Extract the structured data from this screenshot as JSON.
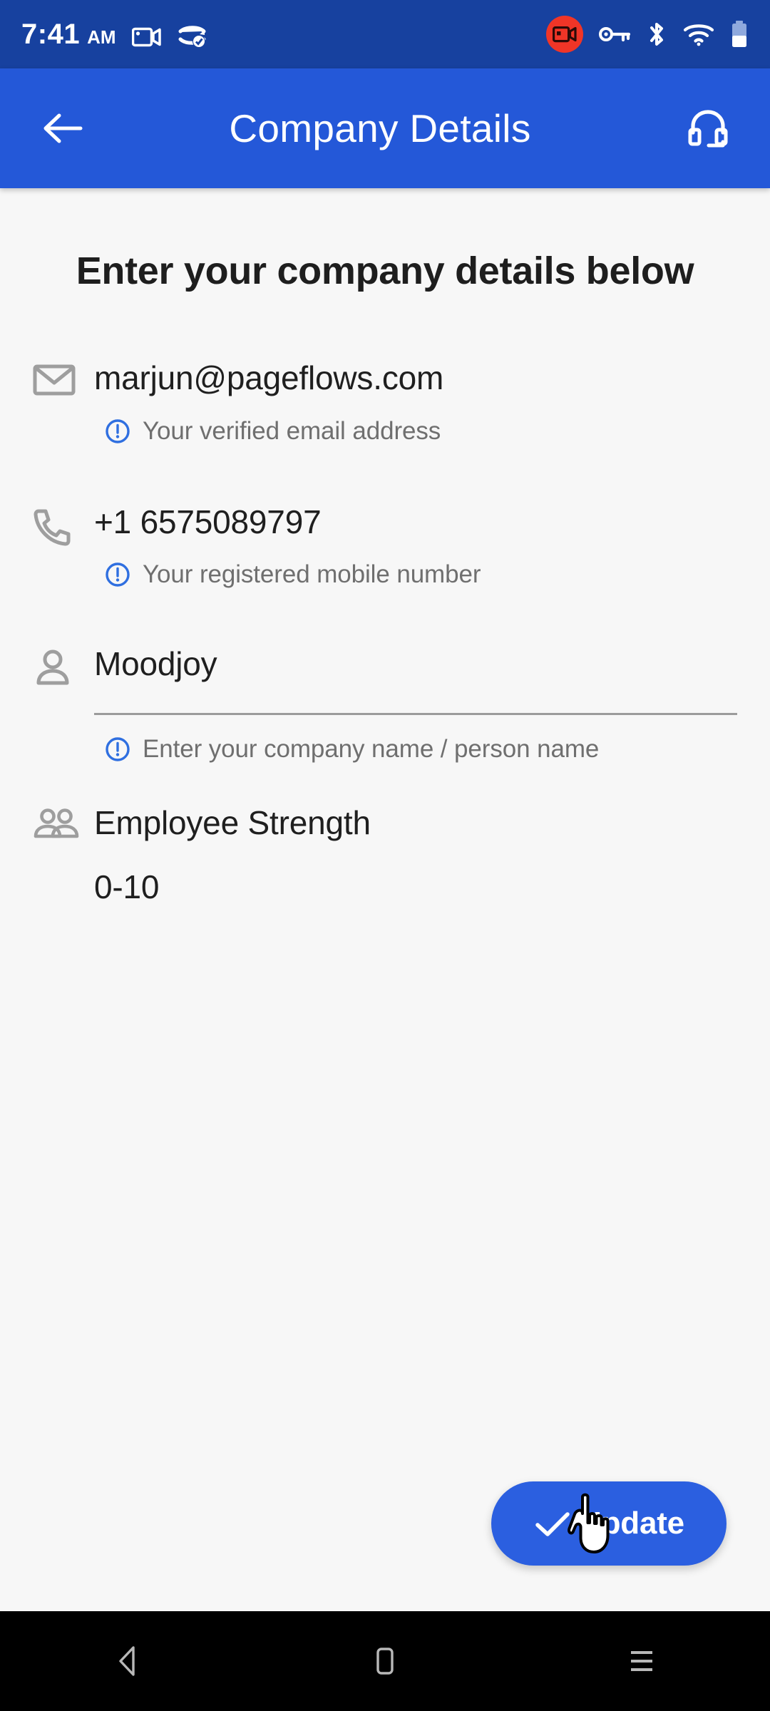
{
  "status_bar": {
    "time": "7:41",
    "ampm": "AM",
    "icons": [
      "video-camera-icon",
      "data-saver-icon",
      "screen-record-badge-icon",
      "vpn-key-icon",
      "bluetooth-icon",
      "wifi-icon",
      "battery-icon"
    ],
    "background_color": "#17419f"
  },
  "app_bar": {
    "title": "Company Details",
    "back_icon": "arrow-left-icon",
    "support_icon": "headset-icon",
    "background_color": "#2458d8",
    "text_color": "#ffffff"
  },
  "page": {
    "heading": "Enter your company details below",
    "background_color": "#f7f7f7"
  },
  "fields": {
    "email": {
      "icon": "envelope-icon",
      "value": "marjun@pageflows.com",
      "hint": "Your verified email address",
      "hint_icon": "info-exclamation-icon"
    },
    "phone": {
      "icon": "phone-icon",
      "value": "+1 6575089797",
      "hint": "Your registered mobile number",
      "hint_icon": "info-exclamation-icon"
    },
    "company_name": {
      "icon": "person-icon",
      "value": "Moodjoy",
      "hint": "Enter your company name / person name",
      "hint_icon": "info-exclamation-icon"
    },
    "employee_strength": {
      "icon": "people-group-icon",
      "label": "Employee Strength",
      "value": "0-10"
    }
  },
  "actions": {
    "update_label": "Update",
    "update_icon": "check-icon",
    "update_color": "#2b5fe0",
    "cursor": "pointer-hand-cursor"
  },
  "nav_bar": {
    "back": "back-triangle-icon",
    "home": "home-square-icon",
    "recents": "recents-lines-icon",
    "background_color": "#000000"
  },
  "colors": {
    "accent_blue": "#2458d8",
    "hint_blue": "#2f6fe0",
    "icon_grey": "#9e9e9e",
    "text_dark": "#1f1f1f",
    "hint_grey": "#6f6f6f",
    "record_red": "#f03527"
  }
}
